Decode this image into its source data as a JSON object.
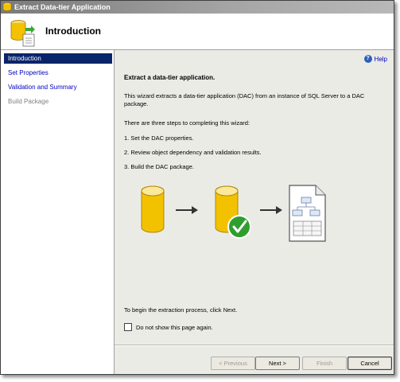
{
  "window": {
    "title": "Extract Data-tier Application"
  },
  "header": {
    "title": "Introduction"
  },
  "nav": {
    "items": [
      {
        "label": "Introduction",
        "state": "selected"
      },
      {
        "label": "Set Properties",
        "state": "link"
      },
      {
        "label": "Validation and Summary",
        "state": "link"
      },
      {
        "label": "Build Package",
        "state": "disabled"
      }
    ]
  },
  "help": {
    "label": "Help",
    "icon": "help-icon"
  },
  "main": {
    "heading": "Extract a data-tier application.",
    "description": "This wizard extracts a data-tier application (DAC) from an instance of SQL Server to a DAC package.",
    "steps_intro": "There are three steps to completing this wizard:",
    "steps": [
      "1. Set the DAC properties.",
      "2. Review object dependency and validation results.",
      "3. Build the DAC package."
    ],
    "footer_text": "To begin the extraction process, click Next.",
    "checkbox_label": "Do not show this page again.",
    "checkbox_checked": false
  },
  "buttons": {
    "previous": "< Previous",
    "next": "Next >",
    "finish": "Finish",
    "cancel": "Cancel"
  },
  "colors": {
    "selected_nav": "#0a246a",
    "link": "#0000c0",
    "database_yellow": "#f2c200",
    "check_green": "#2e9e2e"
  }
}
